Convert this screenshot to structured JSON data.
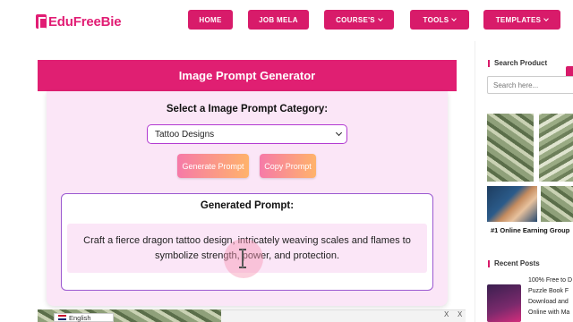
{
  "header": {
    "logo_text": "EduFreeBie",
    "nav": [
      {
        "label": "HOME",
        "has_dropdown": false
      },
      {
        "label": "JOB MELA",
        "has_dropdown": false
      },
      {
        "label": "COURSE'S",
        "has_dropdown": true
      },
      {
        "label": "TOOLS",
        "has_dropdown": true
      },
      {
        "label": "TEMPLATES",
        "has_dropdown": true
      }
    ]
  },
  "generator": {
    "title": "Image Prompt Generator",
    "category_label": "Select a Image Prompt Category:",
    "category_selected": "Tattoo Designs",
    "generate_button": "Generate Prompt",
    "copy_button": "Copy Prompt",
    "output_title": "Generated Prompt:",
    "output_text": "Craft a fierce dragon tattoo design, intricately weaving scales and flames to symbolize strength, power, and protection."
  },
  "sidebar": {
    "search_heading": "Search Product",
    "search_placeholder": "Search here...",
    "earning_label": "#1 Online Earning Group",
    "recent_heading": "Recent Posts",
    "recent_lines": [
      "100% Free to D",
      "Puzzle Book F",
      "Download and",
      "Online with Ma"
    ]
  },
  "ad": {
    "language": "English",
    "close_glyph": "X"
  },
  "colors": {
    "brand": "#d81b6a",
    "header_bar": "#e01f72",
    "panel_bg": "#fbe6f7",
    "outline": "#9b59d0"
  },
  "icons": {
    "cursor": "text-cursor-icon",
    "dropdown": "chevron-down-icon"
  }
}
